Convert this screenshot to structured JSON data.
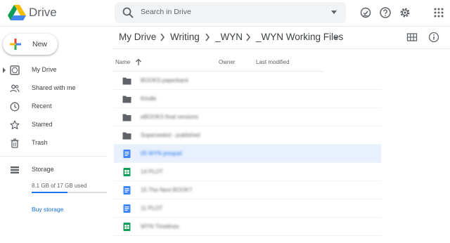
{
  "header": {
    "brand": "Drive",
    "search_placeholder": "Search in Drive",
    "icons": [
      "ready-offline-icon",
      "help-icon",
      "settings-icon",
      "apps-grid-icon"
    ]
  },
  "sidebar": {
    "new_label": "New",
    "items": [
      {
        "label": "My Drive",
        "icon": "my-drive-icon"
      },
      {
        "label": "Shared with me",
        "icon": "people-icon"
      },
      {
        "label": "Recent",
        "icon": "clock-icon"
      },
      {
        "label": "Starred",
        "icon": "star-icon"
      },
      {
        "label": "Trash",
        "icon": "trash-icon"
      }
    ],
    "storage": {
      "label": "Storage",
      "used_text": "8.1 GB of 17 GB used",
      "used_fraction": 0.476,
      "buy_label": "Buy storage"
    }
  },
  "breadcrumb": [
    "My Drive",
    "Writing",
    "_WYN",
    "_WYN Working Files"
  ],
  "list": {
    "columns": {
      "name": "Name",
      "owner": "Owner",
      "modified": "Last modified"
    },
    "rows": [
      {
        "name": "BOOKS paperback",
        "type": "folder",
        "selected": false
      },
      {
        "name": "Kindle",
        "type": "folder",
        "selected": false
      },
      {
        "name": "eBOOKS final versions",
        "type": "folder",
        "selected": false
      },
      {
        "name": "Superseded - published",
        "type": "folder",
        "selected": false
      },
      {
        "name": "05 WYN prequel",
        "type": "doc",
        "selected": true
      },
      {
        "name": "14 PLOT",
        "type": "sheet",
        "selected": false
      },
      {
        "name": "15 The Next BOOK?",
        "type": "doc",
        "selected": false
      },
      {
        "name": "11 PLOT",
        "type": "doc",
        "selected": false
      },
      {
        "name": "WYN Timelines",
        "type": "sheet",
        "selected": false
      }
    ]
  },
  "colors": {
    "accent": "#1a73e8",
    "selected_row": "#e8f0fe",
    "folder": "#5f6368",
    "doc": "#4285f4",
    "sheet": "#0f9d58"
  }
}
